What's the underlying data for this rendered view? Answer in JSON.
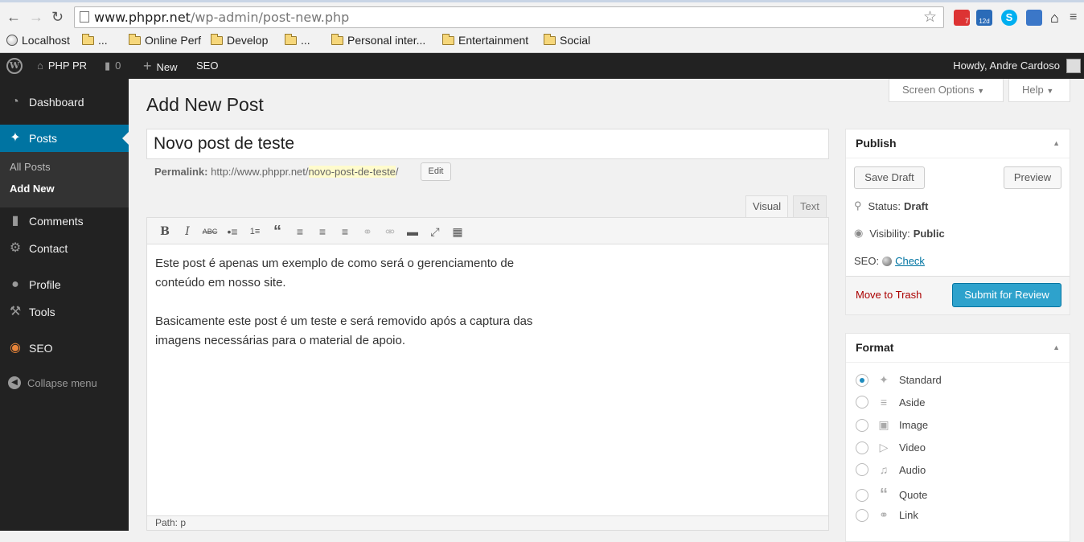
{
  "browser": {
    "url_domain": "www.phppr.net",
    "url_path": "/wp-admin/post-new.php",
    "ext_badges": [
      "7",
      "12d"
    ],
    "bookmarks": [
      "Localhost",
      "...",
      "Online Perf",
      "Develop",
      "...",
      "Personal inter...",
      "Entertainment",
      "Social"
    ]
  },
  "adminbar": {
    "site_name": "PHP PR",
    "comments_count": "0",
    "new_label": "New",
    "seo_label": "SEO",
    "howdy": "Howdy, Andre Cardoso"
  },
  "sidebar": {
    "dashboard": "Dashboard",
    "posts": "Posts",
    "all_posts": "All Posts",
    "add_new": "Add New",
    "comments": "Comments",
    "contact": "Contact",
    "profile": "Profile",
    "tools": "Tools",
    "seo": "SEO",
    "collapse": "Collapse menu"
  },
  "page": {
    "title": "Add New Post",
    "screen_options": "Screen Options",
    "help": "Help",
    "post_title": "Novo post de teste",
    "permalink_label": "Permalink:",
    "permalink_base": "http://www.phppr.net/",
    "permalink_slug": "novo-post-de-teste",
    "permalink_end": "/",
    "edit": "Edit",
    "tab_visual": "Visual",
    "tab_text": "Text",
    "path": "Path: p"
  },
  "content": {
    "p1_line1": "Este post é apenas um exemplo de como será o gerenciamento de",
    "p1_line2": "conteúdo em nosso site.",
    "p2_line1": "Basicamente este post é um teste e será removido após a captura das",
    "p2_line2": "imagens necessárias para o material de apoio."
  },
  "publish": {
    "title": "Publish",
    "save_draft": "Save Draft",
    "preview": "Preview",
    "status_label": "Status:",
    "status_value": "Draft",
    "visibility_label": "Visibility:",
    "visibility_value": "Public",
    "seo_label": "SEO:",
    "seo_check": "Check",
    "trash": "Move to Trash",
    "submit": "Submit for Review"
  },
  "format": {
    "title": "Format",
    "options": [
      "Standard",
      "Aside",
      "Image",
      "Video",
      "Audio",
      "Quote",
      "Link"
    ],
    "selected": "Standard"
  },
  "colors": {
    "accent": "#0074a2",
    "submit": "#2ea2cc",
    "admin_bg": "#222222"
  }
}
